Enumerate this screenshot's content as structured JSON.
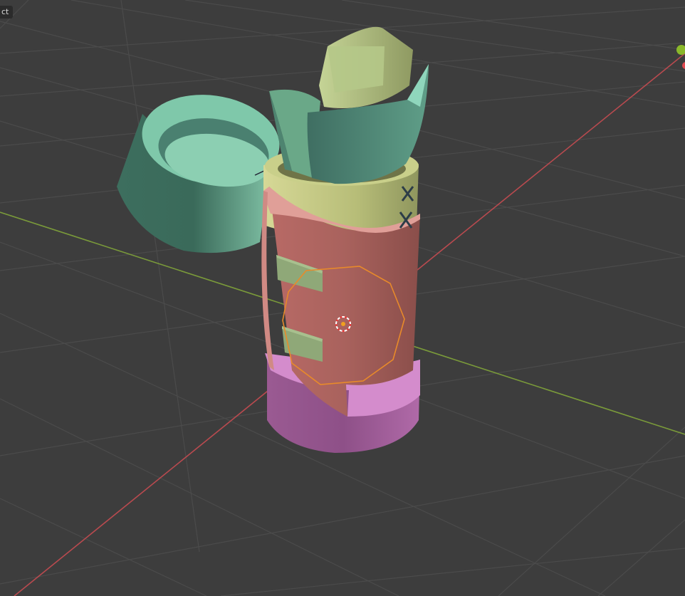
{
  "viewport": {
    "mode_label": "ct",
    "background_color": "#3d3d3d",
    "grid_color": "#4b4b4b",
    "axis_x_color": "#b94a4f",
    "axis_y_color": "#7a9a3a",
    "selection_outline_color": "#e88a2a"
  },
  "scene": {
    "objects": [
      {
        "name": "lid",
        "color": "#7fc8aa"
      },
      {
        "name": "leaf-left",
        "color": "#6aa888"
      },
      {
        "name": "leaf-right",
        "color": "#4f8a78"
      },
      {
        "name": "stalk",
        "color": "#a9be7a"
      },
      {
        "name": "collar",
        "color": "#c9cf8a"
      },
      {
        "name": "body",
        "color": "#c0706a",
        "selected": true
      },
      {
        "name": "patch-top",
        "color": "#8fa878"
      },
      {
        "name": "patch-bottom",
        "color": "#8fa878"
      },
      {
        "name": "base",
        "color": "#c078b8"
      }
    ],
    "icons": [
      "stitch-x-icon",
      "stitch-x-icon",
      "origin-cursor-icon"
    ]
  }
}
